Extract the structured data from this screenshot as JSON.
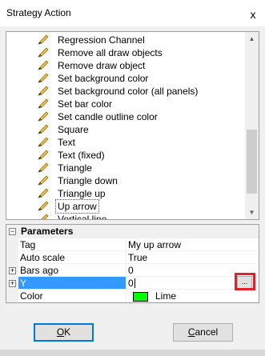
{
  "window": {
    "title": "Strategy Action",
    "close_glyph": "x"
  },
  "actions": [
    "Regression Channel",
    "Remove all draw objects",
    "Remove draw object",
    "Set background color",
    "Set background color (all panels)",
    "Set bar color",
    "Set candle outline color",
    "Square",
    "Text",
    "Text (fixed)",
    "Triangle",
    "Triangle down",
    "Triangle up",
    "Up arrow",
    "Vertical line"
  ],
  "selected_action": "Up arrow",
  "parameters": {
    "category": "Parameters",
    "expander": "⊟",
    "rows": [
      {
        "name": "Tag",
        "value": "My up arrow"
      },
      {
        "name": "Auto scale",
        "value": "True"
      },
      {
        "name": "Bars ago",
        "value": "0",
        "expander": "+"
      },
      {
        "name": "Y",
        "value": "0",
        "expander": "+"
      },
      {
        "name": "Color",
        "value": "Lime",
        "swatch": "#00ff00"
      }
    ],
    "ellipsis_label": "..."
  },
  "buttons": {
    "ok_prefix": "",
    "ok_ul": "O",
    "ok_rest": "K",
    "cancel_ul": "C",
    "cancel_rest": "ancel"
  },
  "colors": {
    "selection": "#3399ff",
    "highlight": "#e0202a",
    "lime": "#00ff00"
  }
}
